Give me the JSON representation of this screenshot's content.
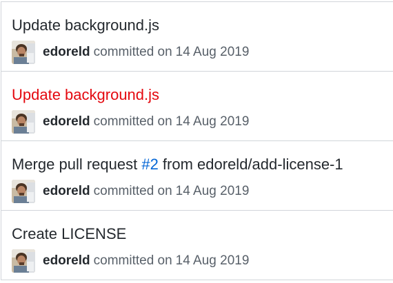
{
  "commits": [
    {
      "title": "Update background.js",
      "highlighted": false,
      "author": "edoreld",
      "action": "committed on",
      "date": "14 Aug 2019"
    },
    {
      "title": "Update background.js",
      "highlighted": true,
      "author": "edoreld",
      "action": "committed on",
      "date": "14 Aug 2019"
    },
    {
      "title_prefix": "Merge pull request ",
      "issue_ref": "#2",
      "title_suffix": " from edoreld/add-license-1",
      "highlighted": false,
      "author": "edoreld",
      "action": "committed on",
      "date": "14 Aug 2019"
    },
    {
      "title": "Create LICENSE",
      "highlighted": false,
      "author": "edoreld",
      "action": "committed on",
      "date": "14 Aug 2019"
    }
  ],
  "colors": {
    "title": "#24292e",
    "highlight": "#e4080f",
    "link": "#0366d6",
    "muted": "#586069",
    "border": "#d1d5da"
  },
  "icons": {
    "avatar": "user-avatar-photo"
  }
}
